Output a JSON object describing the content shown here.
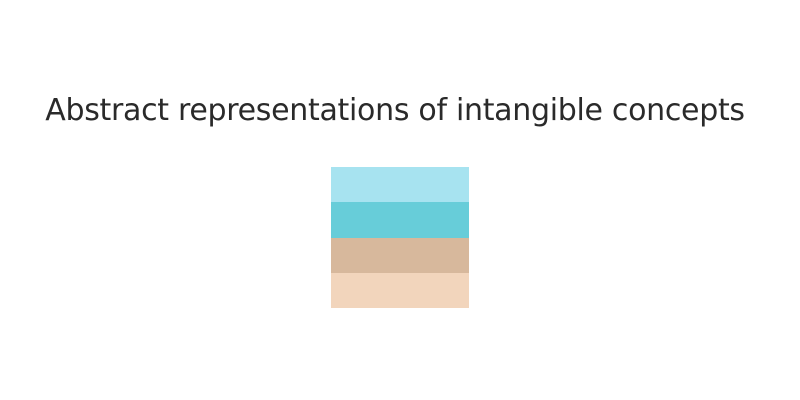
{
  "title": "Abstract representations of intangible concepts",
  "swatches": [
    {
      "name": "light-sky-blue",
      "color": "#a7e3f0"
    },
    {
      "name": "turquoise",
      "color": "#67cdd9"
    },
    {
      "name": "warm-tan",
      "color": "#d7b89c"
    },
    {
      "name": "light-peach",
      "color": "#f2d5bc"
    }
  ]
}
